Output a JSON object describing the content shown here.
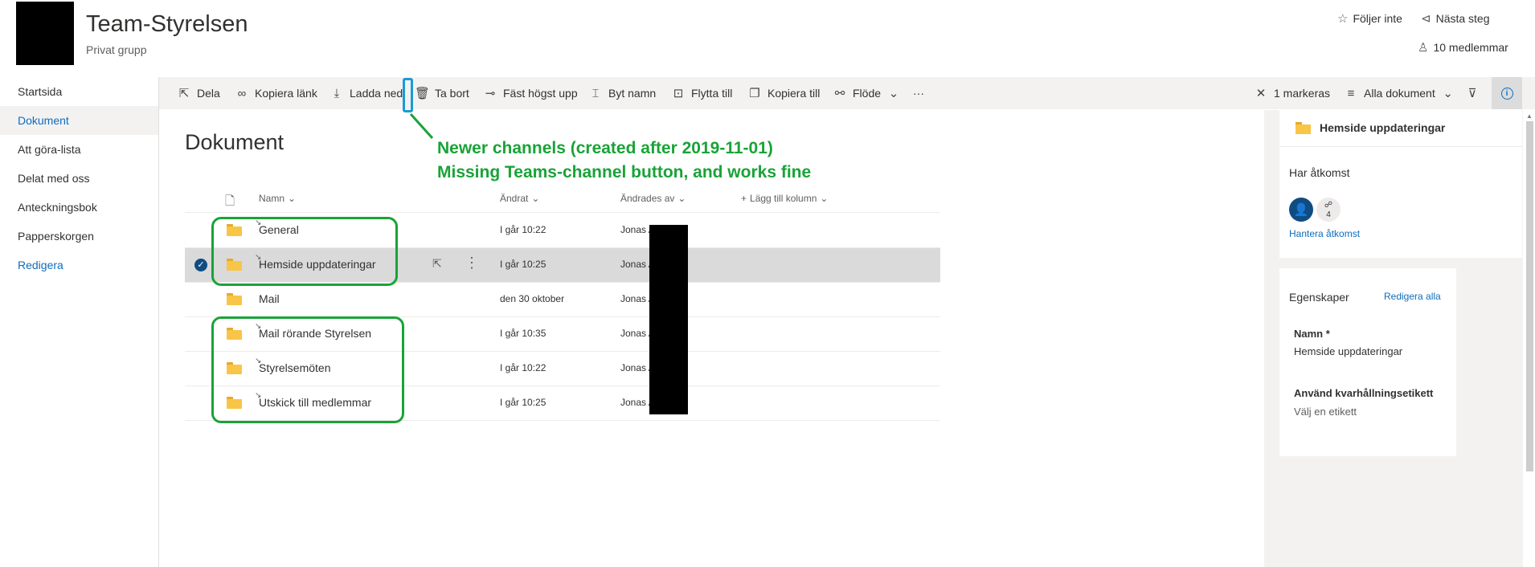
{
  "site": {
    "title": "Team-Styrelsen",
    "subtitle": "Privat grupp",
    "follow": "Följer inte",
    "next_steps": "Nästa steg",
    "members": "10 medlemmar"
  },
  "nav": {
    "items": [
      {
        "label": "Startsida"
      },
      {
        "label": "Dokument"
      },
      {
        "label": "Att göra-lista"
      },
      {
        "label": "Delat med oss"
      },
      {
        "label": "Anteckningsbok"
      },
      {
        "label": "Papperskorgen"
      },
      {
        "label": "Redigera"
      }
    ]
  },
  "toolbar": {
    "share": "Dela",
    "copy_link": "Kopiera länk",
    "download": "Ladda ned",
    "delete": "Ta bort",
    "pin_top": "Fäst högst upp",
    "rename": "Byt namn",
    "move_to": "Flytta till",
    "copy_to": "Kopiera till",
    "flow": "Flöde",
    "more": "···",
    "selected": "1 markeras",
    "view": "Alla dokument"
  },
  "library": {
    "title": "Dokument",
    "columns": {
      "name": "Namn",
      "modified": "Ändrat",
      "modified_by": "Ändrades av",
      "add_column": "Lägg till kolumn"
    },
    "rows": [
      {
        "name": "General",
        "modified": "I går 10:22",
        "modified_by": "Jonas A (RR)"
      },
      {
        "name": "Hemside uppdateringar",
        "modified": "I går 10:25",
        "modified_by": "Jonas A (RR)"
      },
      {
        "name": "Mail",
        "modified": "den 30 oktober",
        "modified_by": "Jonas A (RR)"
      },
      {
        "name": "Mail rörande Styrelsen",
        "modified": "I går 10:35",
        "modified_by": "Jonas A (RR)"
      },
      {
        "name": "Styrelsemöten",
        "modified": "I går 10:22",
        "modified_by": "Jonas A (RR)"
      },
      {
        "name": "Utskick till medlemmar",
        "modified": "I går 10:25",
        "modified_by": "Jonas A (RR)"
      }
    ]
  },
  "annotation": {
    "line1": "Newer channels (created after 2019-11-01)",
    "line2": "Missing Teams-channel button, and works fine",
    "color": "#19a337"
  },
  "details": {
    "folder_name": "Hemside uppdateringar",
    "access_heading": "Har åtkomst",
    "group_count": "4",
    "manage_access": "Hantera åtkomst",
    "properties": "Egenskaper",
    "edit_all": "Redigera alla",
    "name_label": "Namn *",
    "name_value": "Hemside uppdateringar",
    "retention_label": "Använd kvarhållningsetikett",
    "retention_value": "Välj en etikett"
  },
  "colors": {
    "accent": "#0f6cbd",
    "folder": "#f8c546",
    "selected_row": "#dadada"
  }
}
